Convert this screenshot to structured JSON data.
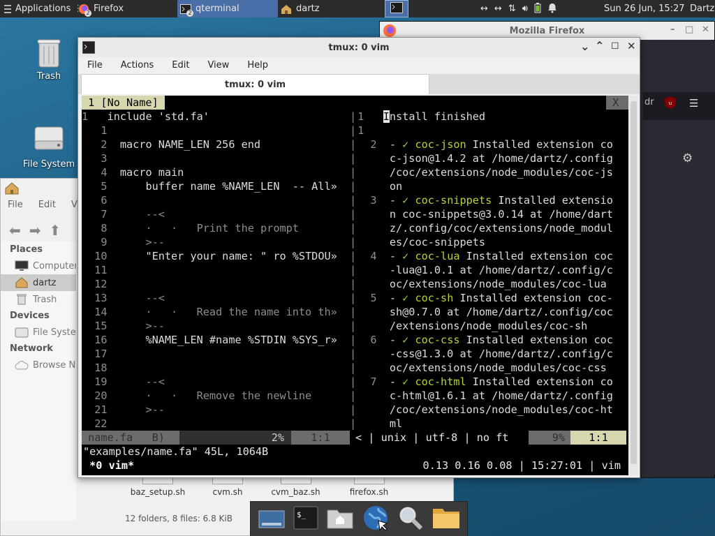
{
  "panel": {
    "applications": "Applications",
    "tasks": [
      {
        "label": "Firefox",
        "badge": "2"
      },
      {
        "label": "qterminal",
        "badge": "2"
      },
      {
        "label": "dartz",
        "badge": ""
      }
    ],
    "clock": "Sun 26 Jun, 15:27",
    "user": "Dartz",
    "tray_icons": [
      "network-icon",
      "network-icon",
      "transfer-icon",
      "volume-icon",
      "battery-icon",
      "notification-bell-icon"
    ]
  },
  "desktop": {
    "icons": [
      {
        "label": "Trash",
        "icon": "trash-icon"
      },
      {
        "label": "File System",
        "icon": "drive-icon"
      }
    ]
  },
  "file_manager": {
    "menu": [
      "File",
      "Edit",
      "Vi"
    ],
    "places_header": "Places",
    "places": [
      "Computer",
      "dartz",
      "Trash"
    ],
    "devices_header": "Devices",
    "devices": [
      "File System"
    ],
    "network_header": "Network",
    "network": [
      "Browse N"
    ],
    "files": [
      "baz_setup.sh",
      "cvm.sh",
      "cvm_baz.sh",
      "firefox.sh"
    ],
    "status": "12 folders, 8 files: 6.8 KiB"
  },
  "firefox": {
    "title": "Mozilla Firefox",
    "partial_text": "dr"
  },
  "terminal": {
    "title": "tmux: 0 vim",
    "menu": [
      "File",
      "Actions",
      "Edit",
      "View",
      "Help"
    ],
    "tab_label": "tmux: 0 vim",
    "vim": {
      "tab_line": " 1 [No Name] ",
      "close_label": " X ",
      "left_lines": [
        {
          "n": "1",
          "text": "include 'std.fa'"
        },
        {
          "n": "1",
          "text": ""
        },
        {
          "n": "2",
          "text": "macro NAME_LEN 256 end"
        },
        {
          "n": "3",
          "text": ""
        },
        {
          "n": "4",
          "text": "macro main"
        },
        {
          "n": "5",
          "text": "    buffer name %NAME_LEN  -- All»"
        },
        {
          "n": "6",
          "text": ""
        },
        {
          "n": "7",
          "text": "    --<"
        },
        {
          "n": "8",
          "text": "    ·   ·   Print the prompt"
        },
        {
          "n": "9",
          "text": "    >--"
        },
        {
          "n": "10",
          "text": "    \"Enter your name: \" ro %STDOU»"
        },
        {
          "n": "11",
          "text": ""
        },
        {
          "n": "12",
          "text": ""
        },
        {
          "n": "13",
          "text": "    --<"
        },
        {
          "n": "14",
          "text": "    ·   ·   Read the name into th»"
        },
        {
          "n": "15",
          "text": "    >--"
        },
        {
          "n": "16",
          "text": "    %NAME_LEN #name %STDIN %SYS_r»"
        },
        {
          "n": "17",
          "text": ""
        },
        {
          "n": "18",
          "text": ""
        },
        {
          "n": "19",
          "text": "    --<"
        },
        {
          "n": "20",
          "text": "    ·   ·   Remove the newline"
        },
        {
          "n": "21",
          "text": "    >--"
        },
        {
          "n": "22",
          "text": ""
        }
      ],
      "right_lines": [
        {
          "n": "1",
          "parts": [
            {
              "t": "I",
              "c": "cursor"
            },
            {
              "t": "nstall finished",
              "c": ""
            }
          ]
        },
        {
          "n": "1",
          "parts": []
        },
        {
          "n": "2",
          "parts": [
            {
              "t": "- ",
              "c": ""
            },
            {
              "t": "✓",
              "c": "ck"
            },
            {
              "t": " ",
              "c": ""
            },
            {
              "t": "coc-json",
              "c": "grn"
            },
            {
              "t": " Installed extension co",
              "c": ""
            }
          ]
        },
        {
          "n": "",
          "parts": [
            {
              "t": "c-json@1.4.2 at /home/dartz/.config",
              "c": ""
            }
          ]
        },
        {
          "n": "",
          "parts": [
            {
              "t": "/coc/extensions/node_modules/coc-js",
              "c": ""
            }
          ]
        },
        {
          "n": "",
          "parts": [
            {
              "t": "on",
              "c": ""
            }
          ]
        },
        {
          "n": "3",
          "parts": [
            {
              "t": "- ",
              "c": ""
            },
            {
              "t": "✓",
              "c": "ck"
            },
            {
              "t": " ",
              "c": ""
            },
            {
              "t": "coc-snippets",
              "c": "grn"
            },
            {
              "t": " Installed extensio",
              "c": ""
            }
          ]
        },
        {
          "n": "",
          "parts": [
            {
              "t": "n coc-snippets@3.0.14 at /home/dart",
              "c": ""
            }
          ]
        },
        {
          "n": "",
          "parts": [
            {
              "t": "z/.config/coc/extensions/node_modul",
              "c": ""
            }
          ]
        },
        {
          "n": "",
          "parts": [
            {
              "t": "es/coc-snippets",
              "c": ""
            }
          ]
        },
        {
          "n": "4",
          "parts": [
            {
              "t": "- ",
              "c": ""
            },
            {
              "t": "✓",
              "c": "ck"
            },
            {
              "t": " ",
              "c": ""
            },
            {
              "t": "coc-lua",
              "c": "grn"
            },
            {
              "t": " Installed extension coc",
              "c": ""
            }
          ]
        },
        {
          "n": "",
          "parts": [
            {
              "t": "-lua@1.0.1 at /home/dartz/.config/c",
              "c": ""
            }
          ]
        },
        {
          "n": "",
          "parts": [
            {
              "t": "oc/extensions/node_modules/coc-lua",
              "c": ""
            }
          ]
        },
        {
          "n": "5",
          "parts": [
            {
              "t": "- ",
              "c": ""
            },
            {
              "t": "✓",
              "c": "ck"
            },
            {
              "t": " ",
              "c": ""
            },
            {
              "t": "coc-sh",
              "c": "grn"
            },
            {
              "t": " Installed extension coc-",
              "c": ""
            }
          ]
        },
        {
          "n": "",
          "parts": [
            {
              "t": "sh@0.7.0 at /home/dartz/.config/coc",
              "c": ""
            }
          ]
        },
        {
          "n": "",
          "parts": [
            {
              "t": "/extensions/node_modules/coc-sh",
              "c": ""
            }
          ]
        },
        {
          "n": "6",
          "parts": [
            {
              "t": "- ",
              "c": ""
            },
            {
              "t": "✓",
              "c": "ck"
            },
            {
              "t": " ",
              "c": ""
            },
            {
              "t": "coc-css",
              "c": "grn"
            },
            {
              "t": " Installed extension coc",
              "c": ""
            }
          ]
        },
        {
          "n": "",
          "parts": [
            {
              "t": "-css@1.3.0 at /home/dartz/.config/c",
              "c": ""
            }
          ]
        },
        {
          "n": "",
          "parts": [
            {
              "t": "oc/extensions/node_modules/coc-css",
              "c": ""
            }
          ]
        },
        {
          "n": "7",
          "parts": [
            {
              "t": "- ",
              "c": ""
            },
            {
              "t": "✓",
              "c": "ck"
            },
            {
              "t": " ",
              "c": ""
            },
            {
              "t": "coc-html",
              "c": "grn"
            },
            {
              "t": " Installed extension co",
              "c": ""
            }
          ]
        },
        {
          "n": "",
          "parts": [
            {
              "t": "c-html@1.6.1 at /home/dartz/.config",
              "c": ""
            }
          ]
        },
        {
          "n": "",
          "parts": [
            {
              "t": "/coc/extensions/node_modules/coc-ht",
              "c": ""
            }
          ]
        },
        {
          "n": "",
          "parts": [
            {
              "t": "ml",
              "c": ""
            }
          ]
        }
      ],
      "status_left_name": " name.fa   B) ",
      "status_left_pct": "2%",
      "status_left_pos": "1:1",
      "status_right_info": "< | unix | utf-8 | no ft",
      "status_right_pct": "9%",
      "status_right_pos": "1:1",
      "message": "\"examples/name.fa\" 45L, 1064B"
    },
    "tmux_window": " *0 vim* ",
    "tmux_right": "0.13 0.16 0.08 | 15:27:01 | vim"
  },
  "dock": {
    "items": [
      "show-desktop-icon",
      "terminal-icon",
      "home-folder-icon",
      "web-browser-icon",
      "search-icon",
      "folder-icon"
    ]
  },
  "colors": {
    "panel_bg": "#2b2b2b",
    "accent": "#4a6ea8",
    "vim_green": "#b5d335",
    "statusline_grey": "#555555",
    "statusline_light": "#d7d7af"
  }
}
